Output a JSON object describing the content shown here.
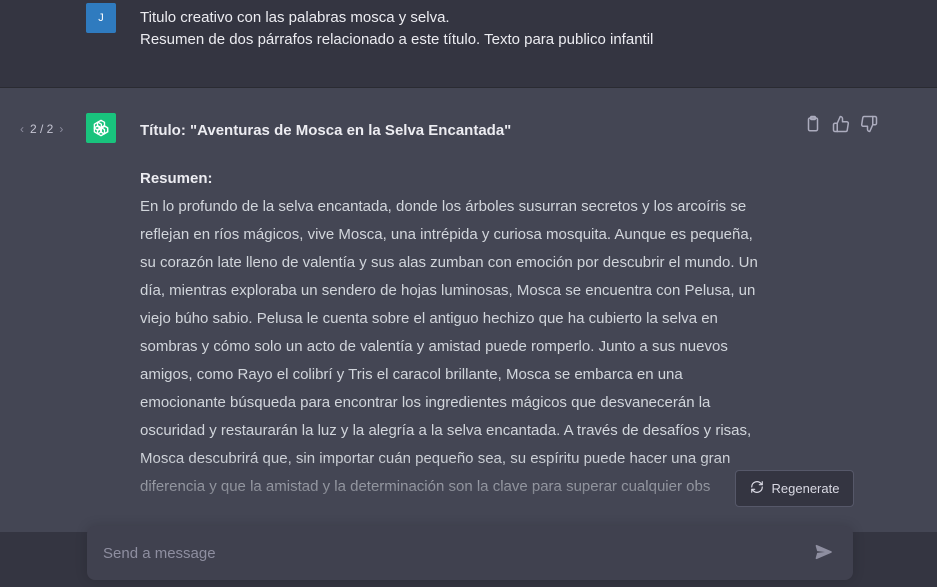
{
  "user_message": {
    "avatar_initial": "J",
    "lines": [
      "Titulo creativo con las palabras mosca y selva.",
      "Resumen de dos párrafos relacionado a este título. Texto para publico infantil"
    ]
  },
  "assistant_message": {
    "pager": "2 / 2",
    "title": "Título: \"Aventuras de Mosca en la Selva Encantada\"",
    "summary_label": "Resumen:",
    "paragraph_lines": [
      "En lo profundo de la selva encantada, donde los árboles susurran secretos y los arcoíris se",
      "reflejan en ríos mágicos, vive Mosca, una intrépida y curiosa mosquita. Aunque es pequeña,",
      "su corazón late lleno de valentía y sus alas zumban con emoción por descubrir el mundo. Un",
      "día, mientras exploraba un sendero de hojas luminosas, Mosca se encuentra con Pelusa, un",
      "viejo búho sabio. Pelusa le cuenta sobre el antiguo hechizo que ha cubierto la selva en",
      "sombras y cómo solo un acto de valentía y amistad puede romperlo. Junto a sus nuevos",
      "amigos, como Rayo el colibrí y Tris el caracol brillante, Mosca se embarca en una",
      "emocionante búsqueda para encontrar los ingredientes mágicos que desvanecerán la",
      "oscuridad y restaurarán la luz y la alegría a la selva encantada. A través de desafíos y risas,",
      "Mosca descubrirá que, sin importar cuán pequeño sea, su espíritu puede hacer una gran",
      "diferencia y que la amistad y la determinación son la clave para superar cualquier obs"
    ],
    "action_icons": [
      "clipboard-icon",
      "thumbs-up-icon",
      "thumbs-down-icon"
    ]
  },
  "regenerate_label": "Regenerate",
  "composer": {
    "placeholder": "Send a message",
    "value": ""
  },
  "colors": {
    "user_bg": "#343541",
    "assistant_bg": "#444654",
    "user_avatar": "#2f7bbf",
    "gpt_avatar": "#19c37d",
    "composer_bg": "#40414f"
  }
}
